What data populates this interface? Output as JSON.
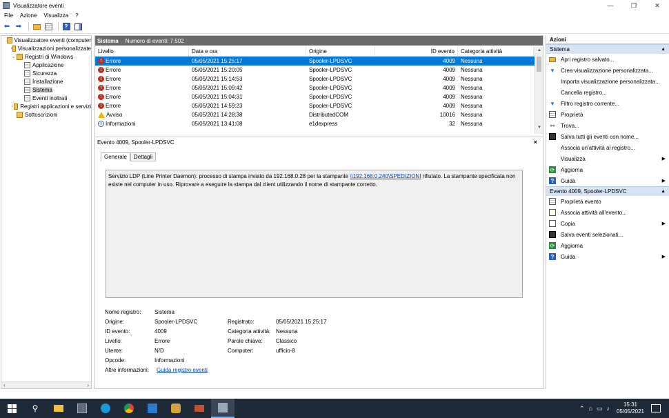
{
  "window": {
    "title": "Visualizzatore eventi",
    "minimize": "—",
    "restore": "❐",
    "close": "✕"
  },
  "menu": [
    "File",
    "Azione",
    "Visualizza",
    "?"
  ],
  "tree": {
    "items": [
      {
        "label": "Visualizzatore eventi (computer",
        "arrow": "",
        "indent": 0
      },
      {
        "label": "Visualizzazioni personalizzate",
        "arrow": "›",
        "indent": 1
      },
      {
        "label": "Registri di Windows",
        "arrow": "⌄",
        "indent": 1
      },
      {
        "label": "Applicazione",
        "arrow": "",
        "indent": 2
      },
      {
        "label": "Sicurezza",
        "arrow": "",
        "indent": 2
      },
      {
        "label": "Installazione",
        "arrow": "",
        "indent": 2
      },
      {
        "label": "Sistema",
        "arrow": "",
        "indent": 2,
        "selected": true
      },
      {
        "label": "Eventi inoltrati",
        "arrow": "",
        "indent": 2
      },
      {
        "label": "Registri applicazioni e servizi",
        "arrow": "›",
        "indent": 1
      },
      {
        "label": "Sottoscrizioni",
        "arrow": "",
        "indent": 1
      }
    ]
  },
  "center": {
    "header_title": "Sistema",
    "header_count": "Numero di eventi: 7.502",
    "columns": [
      "Livello",
      "Data e ora",
      "Origine",
      "ID evento",
      "Categoria attività"
    ],
    "rows": [
      {
        "level": "Errore",
        "type": "err",
        "date": "05/05/2021 15:25:17",
        "source": "Spooler-LPDSVC",
        "id": "4009",
        "cat": "Nessuna",
        "selected": true
      },
      {
        "level": "Errore",
        "type": "err",
        "date": "05/05/2021 15:20:05",
        "source": "Spooler-LPDSVC",
        "id": "4009",
        "cat": "Nessuna"
      },
      {
        "level": "Errore",
        "type": "err",
        "date": "05/05/2021 15:14:53",
        "source": "Spooler-LPDSVC",
        "id": "4009",
        "cat": "Nessuna"
      },
      {
        "level": "Errore",
        "type": "err",
        "date": "05/05/2021 15:09:42",
        "source": "Spooler-LPDSVC",
        "id": "4009",
        "cat": "Nessuna"
      },
      {
        "level": "Errore",
        "type": "err",
        "date": "05/05/2021 15:04:31",
        "source": "Spooler-LPDSVC",
        "id": "4009",
        "cat": "Nessuna"
      },
      {
        "level": "Errore",
        "type": "err",
        "date": "05/05/2021 14:59:23",
        "source": "Spooler-LPDSVC",
        "id": "4009",
        "cat": "Nessuna"
      },
      {
        "level": "Avviso",
        "type": "warn",
        "date": "05/05/2021 14:28:38",
        "source": "DistributedCOM",
        "id": "10016",
        "cat": "Nessuna"
      },
      {
        "level": "Informazioni",
        "type": "info",
        "date": "05/05/2021 13:41:08",
        "source": "e1dexpress",
        "id": "32",
        "cat": "Nessuna"
      }
    ]
  },
  "detail": {
    "title": "Evento 4009, Spooler-LPDSVC",
    "close": "×",
    "tabs": [
      "Generale",
      "Dettagli"
    ],
    "description_pre": "Servizio LDP (Line Printer Daemon): processo di stampa inviato da 192.168.0.28 per la stampante ",
    "description_link": "\\\\192.168.0.240\\SPEDIZIONI",
    "description_post": " rifiutato. La stampante specificata non esiste nel computer in uso. Riprovare a eseguire la stampa dal client utilizzando il nome di stampante corretto.",
    "props": {
      "nome_registro_label": "Nome registro:",
      "nome_registro": "Sistema",
      "origine_label": "Origine:",
      "origine": "Spooler-LPDSVC",
      "registrato_label": "Registrato:",
      "registrato": "05/05/2021 15:25:17",
      "id_label": "ID evento:",
      "id": "4009",
      "categoria_label": "Categoria attività:",
      "categoria": "Nessuna",
      "livello_label": "Livello:",
      "livello": "Errore",
      "parole_label": "Parole chiave:",
      "parole": "Classico",
      "utente_label": "Utente:",
      "utente": "N/D",
      "computer_label": "Computer:",
      "computer": "ufficio-8",
      "opcode_label": "Opcode:",
      "opcode": "Informazioni",
      "altre_label": "Altre informazioni:",
      "altre_link": "Guida registro eventi"
    }
  },
  "actions": {
    "header": "Azioni",
    "section1": "Sistema",
    "section1_items": [
      {
        "label": "Apri registro salvato...",
        "icon": "folder-icon",
        "more": false
      },
      {
        "label": "Crea visualizzazione personalizzata...",
        "icon": "filter-icon",
        "more": false
      },
      {
        "label": "Importa visualizzazione personalizzata...",
        "icon": "",
        "more": false
      },
      {
        "label": "Cancella registro...",
        "icon": "",
        "more": false
      },
      {
        "label": "Filtro registro corrente...",
        "icon": "filter-icon",
        "more": false
      },
      {
        "label": "Proprietà",
        "icon": "properties-icon",
        "more": false
      },
      {
        "label": "Trova...",
        "icon": "find-icon",
        "more": false
      },
      {
        "label": "Salva tutti gli eventi con nome...",
        "icon": "save-icon",
        "more": false
      },
      {
        "label": "Associa un'attività al registro...",
        "icon": "",
        "more": false
      },
      {
        "label": "Visualizza",
        "icon": "",
        "more": true
      },
      {
        "label": "Aggiorna",
        "icon": "refresh-icon",
        "more": false
      },
      {
        "label": "Guida",
        "icon": "help-icon",
        "more": true
      }
    ],
    "section2": "Evento 4009, Spooler-LPDSVC",
    "section2_items": [
      {
        "label": "Proprietà evento",
        "icon": "properties-icon",
        "more": false
      },
      {
        "label": "Associa attività all'evento...",
        "icon": "task-icon",
        "more": false
      },
      {
        "label": "Copia",
        "icon": "copy-icon",
        "more": true
      },
      {
        "label": "Salva eventi selezionati...",
        "icon": "save-icon",
        "more": false
      },
      {
        "label": "Aggiorna",
        "icon": "refresh-icon",
        "more": false
      },
      {
        "label": "Guida",
        "icon": "help-icon",
        "more": true
      }
    ]
  },
  "taskbar": {
    "time": "15:31",
    "date": "05/05/2021"
  }
}
